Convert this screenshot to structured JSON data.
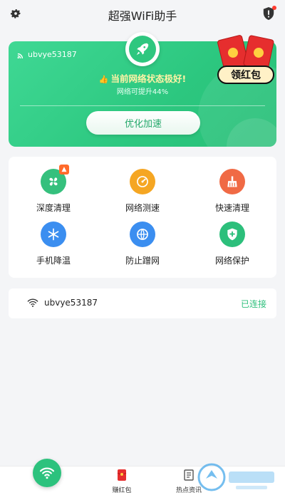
{
  "header": {
    "title": "超强WiFi助手"
  },
  "hero": {
    "ssid": "ubvye53187",
    "status": "当前网络状态极好!",
    "status_icon": "thumbs-up-icon",
    "subtext": "网络可提升44%",
    "boost_button": "优化加速",
    "redpacket_label": "领红包"
  },
  "tools": [
    {
      "label": "深度清理",
      "icon": "fan-icon",
      "color": "#35c07d",
      "badge": true
    },
    {
      "label": "网络测速",
      "icon": "speedometer-icon",
      "color": "#f5a623"
    },
    {
      "label": "快速清理",
      "icon": "broom-icon",
      "color": "#f06a45"
    },
    {
      "label": "手机降温",
      "icon": "snowflake-icon",
      "color": "#3b8ef0"
    },
    {
      "label": "防止蹭网",
      "icon": "globe-shield-icon",
      "color": "#3b8ef0"
    },
    {
      "label": "网络保护",
      "icon": "shield-plus-icon",
      "color": "#2cbf7b"
    }
  ],
  "wifi": {
    "ssid": "ubvye53187",
    "status": "已连接"
  },
  "bottom": {
    "tabs": [
      {
        "label": "赚红包",
        "icon": "red-packet-icon"
      },
      {
        "label": "热点资讯",
        "icon": "news-icon"
      }
    ]
  },
  "colors": {
    "accent": "#2cc27d",
    "connected": "#2cbf7b"
  }
}
